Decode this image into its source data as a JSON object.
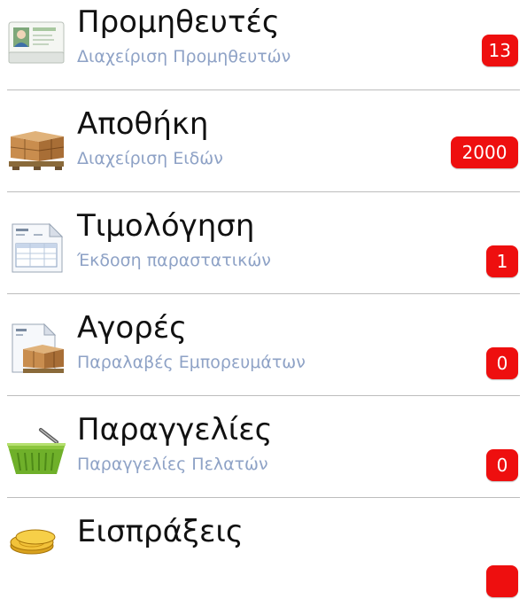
{
  "menu": {
    "items": [
      {
        "title": "Προμηθευτές",
        "subtitle": "Διαχείριση Προμηθευτών",
        "badge": "13",
        "icon": "customer-card-icon"
      },
      {
        "title": "Αποθήκη",
        "subtitle": "Διαχείριση Ειδών",
        "badge": "2000",
        "icon": "warehouse-boxes-icon"
      },
      {
        "title": "Τιμολόγηση",
        "subtitle": "Έκδοση παραστατικών",
        "badge": "1",
        "icon": "invoice-document-icon"
      },
      {
        "title": "Αγορές",
        "subtitle": "Παραλαβές Εμπορευμάτων",
        "badge": "0",
        "icon": "purchases-icon"
      },
      {
        "title": "Παραγγελίες",
        "subtitle": "Παραγγελίες Πελατών",
        "badge": "0",
        "icon": "shopping-basket-icon"
      },
      {
        "title": "Εισπράξεις",
        "subtitle": "",
        "badge": "",
        "icon": "gold-coins-icon"
      }
    ]
  },
  "colors": {
    "badge": "#ee0f0f",
    "subtitle": "#8ea2c6",
    "divider": "#bdbdbd"
  }
}
